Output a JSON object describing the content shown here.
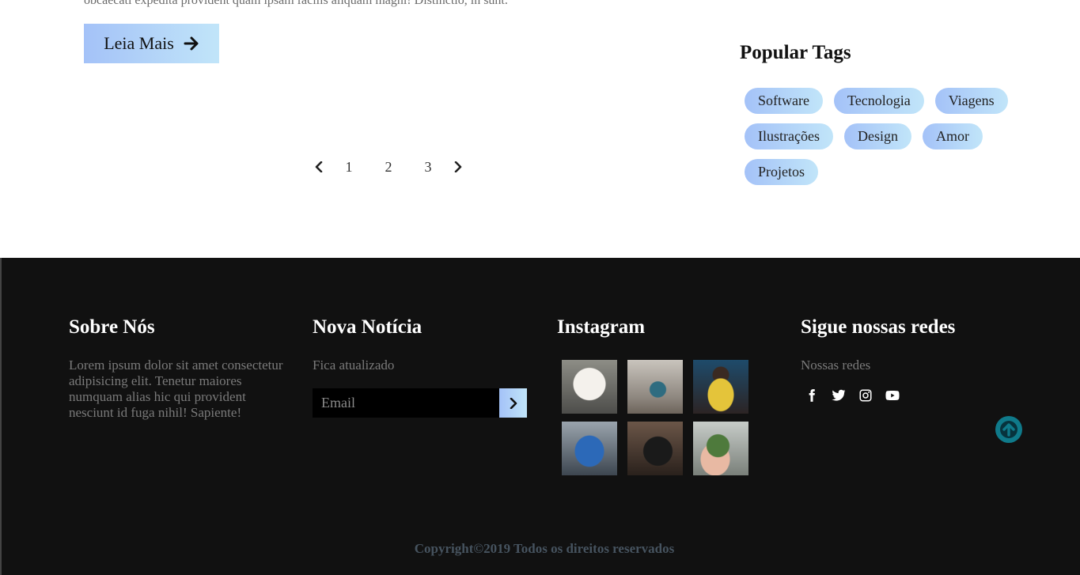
{
  "article": {
    "excerpt": "obcaecati expedita provident quam ipsam facilis aliquam magni! Distinctio, in sunt.",
    "read_more_label": "Leia Mais"
  },
  "pagination": {
    "pages": [
      "1",
      "2",
      "3"
    ]
  },
  "tags": {
    "title": "Popular Tags",
    "items": [
      "Software",
      "Tecnologia",
      "Viagens",
      "Ilustrações",
      "Design",
      "Amor",
      "Projetos"
    ]
  },
  "footer": {
    "about": {
      "title": "Sobre Nós",
      "text": "Lorem ipsum dolor sit amet consectetur adipisicing elit. Tenetur maiores numquam alias hic qui provident nesciunt id fuga nihil! Sapiente!"
    },
    "newsletter": {
      "title": "Nova Notícia",
      "text": "Fica atualizado",
      "email_placeholder": "Email"
    },
    "instagram": {
      "title": "Instagram",
      "photos": [
        "dog-photo",
        "woman-city-photo",
        "man-yellow-sweater-photo",
        "blue-toy-car-photo",
        "camera-photo",
        "hand-plant-photo"
      ]
    },
    "social": {
      "title": "Sigue nossas redes",
      "text": "Nossas redes",
      "icons": [
        "facebook-icon",
        "twitter-icon",
        "instagram-icon",
        "youtube-icon"
      ]
    },
    "copyright": "Copyright©2019 Todos os direitos reservados"
  },
  "colors": {
    "accent_gradient_start": "#a4c2f8",
    "accent_gradient_end": "#c1e5f9",
    "footer_bg": "#111111",
    "back_to_top": "#0f7a8a"
  }
}
